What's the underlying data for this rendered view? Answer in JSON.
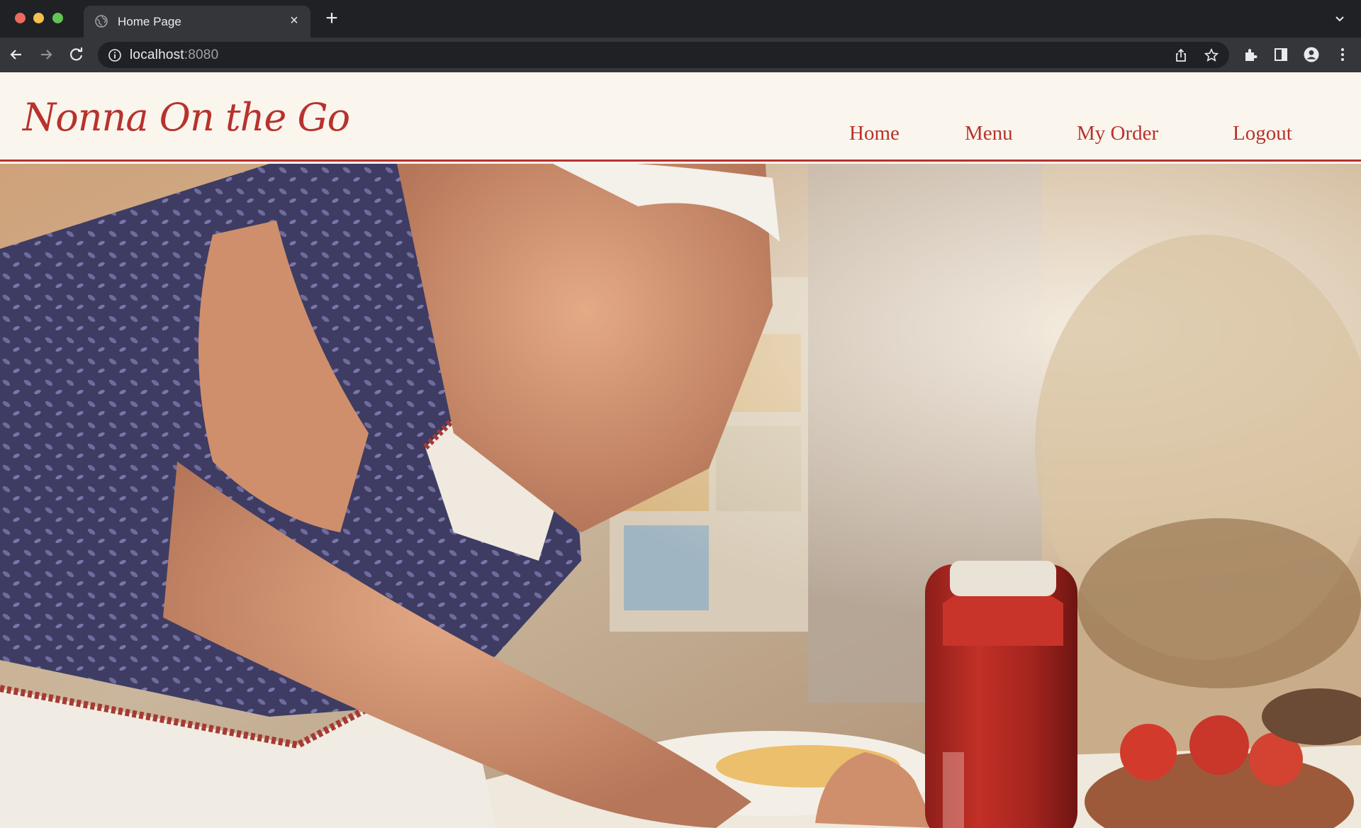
{
  "browser": {
    "tab_title": "Home Page",
    "close_glyph": "×",
    "new_tab_glyph": "+",
    "url_host": "localhost",
    "url_port": ":8080",
    "icons": [
      "globe-icon",
      "close-icon",
      "plus-icon",
      "chevron-down-icon",
      "back-arrow-icon",
      "forward-arrow-icon",
      "reload-icon",
      "info-icon",
      "share-icon",
      "star-icon",
      "extensions-icon",
      "side-panel-icon",
      "profile-icon",
      "kebab-menu-icon"
    ]
  },
  "site": {
    "brand": "Nonna On the Go",
    "brand_color": "#b8322d",
    "background_color": "#faf6ee",
    "nav": {
      "home": "Home",
      "menu": "Menu",
      "my_order": "My Order",
      "logout": "Logout"
    },
    "hero": {
      "image_semantic": "elderly woman kneading flour and eggs in a kitchen, tomato sauce bottle in foreground"
    }
  }
}
